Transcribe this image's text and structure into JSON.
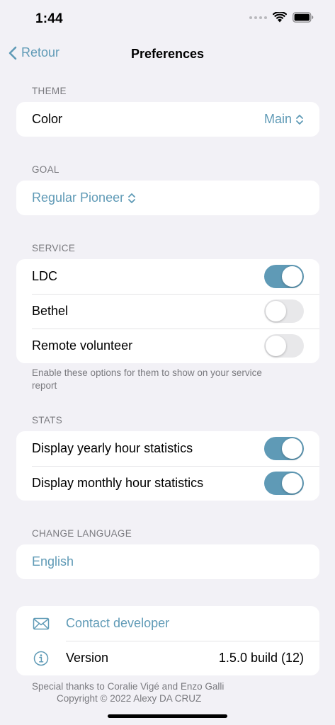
{
  "status_bar": {
    "time": "1:44",
    "icons": [
      "signal-dots-icon",
      "wifi-icon",
      "battery-icon"
    ]
  },
  "nav": {
    "back_label": "Retour",
    "title": "Preferences"
  },
  "theme": {
    "header": "THEME",
    "color_label": "Color",
    "color_value": "Main"
  },
  "goal": {
    "header": "GOAL",
    "value": "Regular Pioneer"
  },
  "service": {
    "header": "SERVICE",
    "items": [
      {
        "label": "LDC",
        "on": true
      },
      {
        "label": "Bethel",
        "on": false
      },
      {
        "label": "Remote volunteer",
        "on": false
      }
    ],
    "footer": "Enable these options for them to show on your service report"
  },
  "stats": {
    "header": "STATS",
    "items": [
      {
        "label": "Display yearly hour statistics",
        "on": true
      },
      {
        "label": "Display monthly hour statistics",
        "on": true
      }
    ]
  },
  "language": {
    "header": "CHANGE LANGUAGE",
    "value": "English"
  },
  "about": {
    "contact_label": "Contact developer",
    "version_label": "Version",
    "version_value": "1.5.0 build (12)"
  },
  "credits": {
    "thanks": "Special thanks to Coralie Vigé and Enzo Galli",
    "copyright": "Copyright © 2022 Alexy DA CRUZ"
  },
  "colors": {
    "accent": "#5f9ab6",
    "background": "#f2f1f6",
    "toggle_off": "#e8e8ea"
  }
}
